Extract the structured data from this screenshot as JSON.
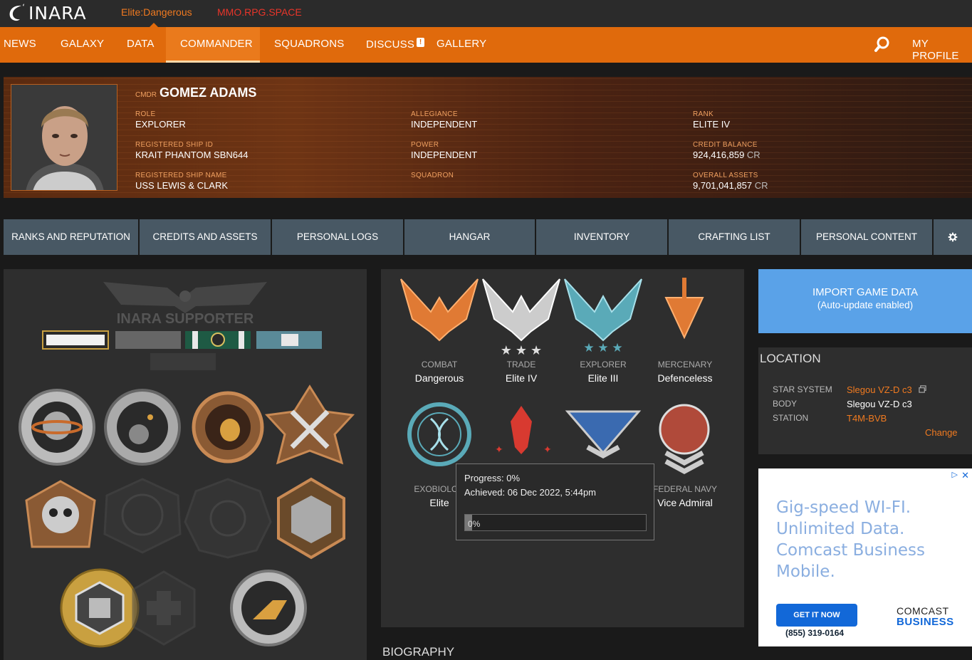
{
  "topbar": {
    "logo": "INARA",
    "sites": [
      "Elite:Dangerous",
      "MMO.RPG.SPACE"
    ]
  },
  "nav": {
    "items": [
      "NEWS",
      "GALAXY",
      "DATA",
      "COMMANDER",
      "SQUADRONS",
      "DISCUSS",
      "GALLERY",
      "MY PROFILE"
    ],
    "active": "COMMANDER",
    "discuss_badge": "!"
  },
  "commander": {
    "prefix": "CMDR",
    "name": "GOMEZ ADAMS",
    "fields": {
      "role": {
        "label": "ROLE",
        "value": "EXPLORER"
      },
      "allegiance": {
        "label": "ALLEGIANCE",
        "value": "INDEPENDENT"
      },
      "rank": {
        "label": "RANK",
        "value": "ELITE IV"
      },
      "ship_id": {
        "label": "REGISTERED SHIP ID",
        "value": "KRAIT PHANTOM SBN644"
      },
      "power": {
        "label": "POWER",
        "value": "INDEPENDENT"
      },
      "credit_balance": {
        "label": "CREDIT BALANCE",
        "value": "924,416,859",
        "unit": "CR"
      },
      "ship_name": {
        "label": "REGISTERED SHIP NAME",
        "value": "USS LEWIS & CLARK"
      },
      "squadron": {
        "label": "SQUADRON",
        "value": ""
      },
      "overall_assets": {
        "label": "OVERALL ASSETS",
        "value": "9,701,041,857",
        "unit": "CR"
      }
    }
  },
  "tabs": [
    "RANKS AND REPUTATION",
    "CREDITS AND ASSETS",
    "PERSONAL LOGS",
    "HANGAR",
    "INVENTORY",
    "CRAFTING LIST",
    "PERSONAL CONTENT"
  ],
  "medals": {
    "supporter_label": "INARA SUPPORTER"
  },
  "ranks": [
    {
      "label": "COMBAT",
      "value": "Dangerous"
    },
    {
      "label": "TRADE",
      "value": "Elite IV"
    },
    {
      "label": "EXPLORER",
      "value": "Elite III"
    },
    {
      "label": "MERCENARY",
      "value": "Defenceless"
    },
    {
      "label": "EXOBIOLOG",
      "value": "Elite"
    },
    {
      "label": "FEDERAL NAVY",
      "value": "Vice Admiral"
    }
  ],
  "tooltip": {
    "progress": "Progress: 0%",
    "achieved": "Achieved: 06 Dec 2022, 5:44pm",
    "bar_label": "0%",
    "bar_fraction": 0.04
  },
  "biography_title": "BIOGRAPHY",
  "import": {
    "title": "IMPORT GAME DATA",
    "subtitle": "(Auto-update enabled)"
  },
  "location": {
    "title": "LOCATION",
    "star_system": {
      "label": "STAR SYSTEM",
      "value": "Slegou VZ-D c3"
    },
    "body": {
      "label": "BODY",
      "value": "Slegou VZ-D c3"
    },
    "station": {
      "label": "STATION",
      "value": "T4M-BVB"
    },
    "change": "Change"
  },
  "ad": {
    "headline": "Gig-speed WI-FI. Unlimited Data. Comcast Business Mobile.",
    "button": "GET IT NOW",
    "phone": "(855) 319-0164",
    "brand_top": "COMCAST",
    "brand_bottom": "BUSINESS"
  },
  "colors": {
    "accent": "#e06a0c",
    "tab": "#485864",
    "link": "#f07a20",
    "import": "#5aa2e8"
  }
}
